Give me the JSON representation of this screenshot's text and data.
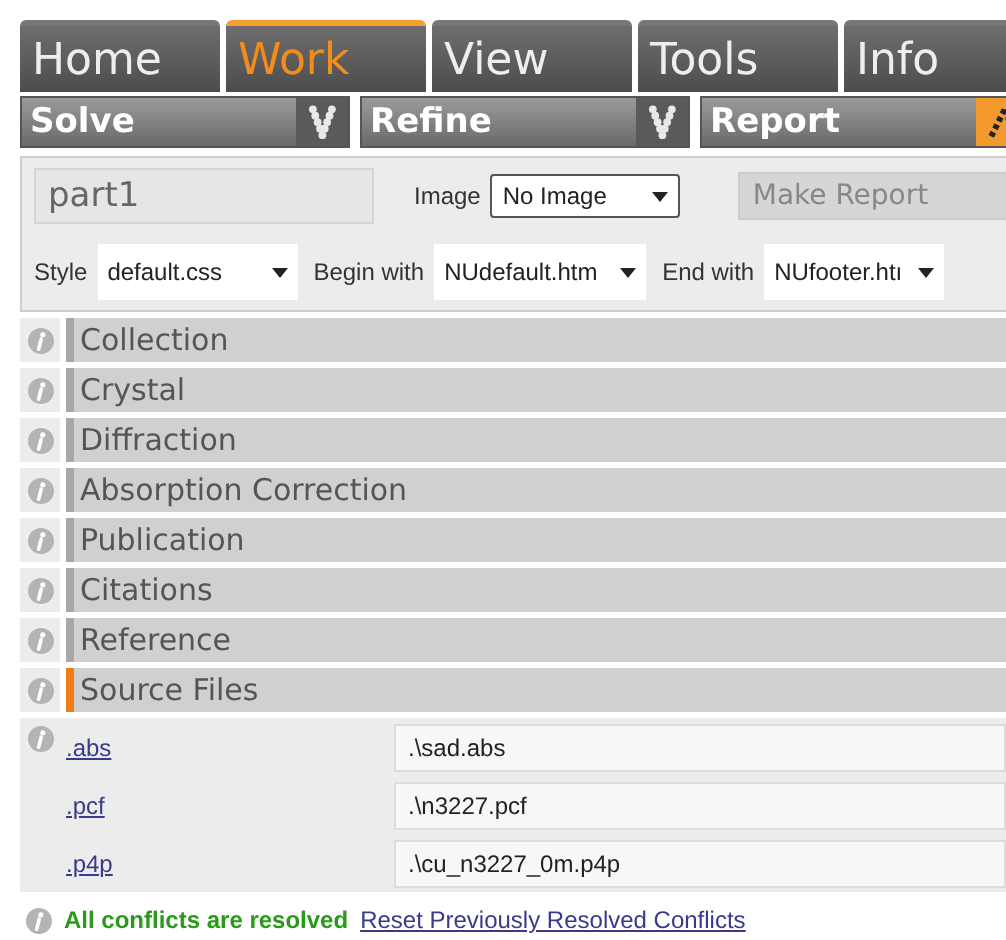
{
  "tabs": [
    {
      "label": "Home",
      "selected": false
    },
    {
      "label": "Work",
      "selected": true
    },
    {
      "label": "View",
      "selected": false
    },
    {
      "label": "Tools",
      "selected": false
    },
    {
      "label": "Info",
      "selected": false
    }
  ],
  "toolbar": [
    {
      "label": "Solve",
      "active": false
    },
    {
      "label": "Refine",
      "active": false
    },
    {
      "label": "Report",
      "active": true
    }
  ],
  "report_form": {
    "name_field": {
      "value": "part1"
    },
    "image_label": "Image",
    "image_select": "No Image",
    "make_report_button": {
      "label": "Make Report",
      "disabled": true
    },
    "style_label": "Style",
    "style_select": "default.css",
    "begin_label": "Begin with",
    "begin_select": "NUdefault.htm",
    "end_label": "End with",
    "end_select": "NUfooter.htı"
  },
  "sections": [
    {
      "title": "Collection",
      "expanded": false
    },
    {
      "title": "Crystal",
      "expanded": false
    },
    {
      "title": "Diffraction",
      "expanded": false
    },
    {
      "title": "Absorption Correction",
      "expanded": false
    },
    {
      "title": "Publication",
      "expanded": false
    },
    {
      "title": "Citations",
      "expanded": false
    },
    {
      "title": "Reference",
      "expanded": false
    },
    {
      "title": "Source Files",
      "expanded": true
    }
  ],
  "source_files": [
    {
      "label": ".abs",
      "value": ".\\sad.abs"
    },
    {
      "label": ".pcf",
      "value": ".\\n3227.pcf"
    },
    {
      "label": ".p4p",
      "value": ".\\cu_n3227_0m.p4p"
    }
  ],
  "footer": {
    "status": "All conflicts are resolved",
    "link": "Reset Previously Resolved Conflicts"
  }
}
